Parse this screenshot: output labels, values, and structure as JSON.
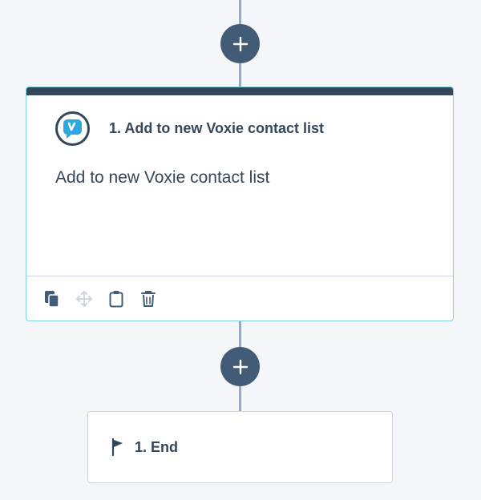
{
  "workflow": {
    "add_step_buttons": [
      {
        "icon": "plus-icon"
      },
      {
        "icon": "plus-icon"
      }
    ],
    "action_card": {
      "step_title": "1. Add to new Voxie contact list",
      "description": "Add to new Voxie contact list",
      "app_icon": "voxie-logo",
      "tools": [
        {
          "icon": "clone-icon"
        },
        {
          "icon": "move-icon"
        },
        {
          "icon": "clipboard-icon"
        },
        {
          "icon": "trash-icon"
        }
      ]
    },
    "end_card": {
      "label": "1. End",
      "icon": "flag-icon"
    }
  },
  "colors": {
    "background": "#f4f6fa",
    "connector": "#99a9bf",
    "add_button": "#425b76",
    "card_border_active": "#7fd1de",
    "card_stripe": "#33475b",
    "text": "#33475b",
    "voxie_brand": "#2aa8e0"
  }
}
